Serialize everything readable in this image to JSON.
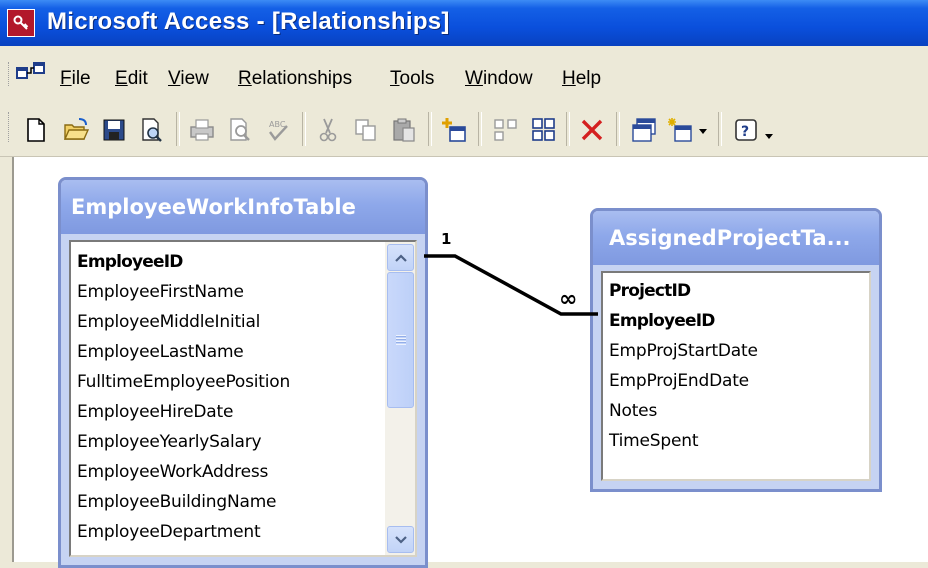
{
  "window": {
    "title": "Microsoft Access - [Relationships]"
  },
  "menu": {
    "items": [
      {
        "label": "File"
      },
      {
        "label": "Edit"
      },
      {
        "label": "View"
      },
      {
        "label": "Relationships"
      },
      {
        "label": "Tools"
      },
      {
        "label": "Window"
      },
      {
        "label": "Help"
      }
    ]
  },
  "toolbar": {
    "buttons": [
      {
        "icon": "new-icon"
      },
      {
        "icon": "open-icon"
      },
      {
        "icon": "save-icon"
      },
      {
        "icon": "file-search-icon"
      },
      {
        "icon": "print-icon"
      },
      {
        "icon": "print-preview-icon"
      },
      {
        "icon": "spelling-icon"
      },
      {
        "icon": "cut-icon"
      },
      {
        "icon": "copy-icon"
      },
      {
        "icon": "paste-icon"
      },
      {
        "icon": "show-table-icon"
      },
      {
        "icon": "show-direct-icon"
      },
      {
        "icon": "show-all-icon"
      },
      {
        "icon": "delete-icon"
      },
      {
        "icon": "database-window-icon"
      },
      {
        "icon": "new-object-icon"
      },
      {
        "icon": "help-icon"
      }
    ]
  },
  "tables": {
    "employee": {
      "name": "EmployeeWorkInfoTable",
      "fields": [
        {
          "name": "EmployeeID",
          "primary_key": true
        },
        {
          "name": "EmployeeFirstName",
          "primary_key": false
        },
        {
          "name": "EmployeeMiddleInitial",
          "primary_key": false
        },
        {
          "name": "EmployeeLastName",
          "primary_key": false
        },
        {
          "name": "FulltimeEmployeePosition",
          "primary_key": false
        },
        {
          "name": "EmployeeHireDate",
          "primary_key": false
        },
        {
          "name": "EmployeeYearlySalary",
          "primary_key": false
        },
        {
          "name": "EmployeeWorkAddress",
          "primary_key": false
        },
        {
          "name": "EmployeeBuildingName",
          "primary_key": false
        },
        {
          "name": "EmployeeDepartment",
          "primary_key": false
        }
      ]
    },
    "assigned": {
      "name": "AssignedProjectTa...",
      "fields": [
        {
          "name": "ProjectID",
          "primary_key": true
        },
        {
          "name": "EmployeeID",
          "primary_key": true
        },
        {
          "name": "EmpProjStartDate",
          "primary_key": false
        },
        {
          "name": "EmpProjEndDate",
          "primary_key": false
        },
        {
          "name": "Notes",
          "primary_key": false
        },
        {
          "name": "TimeSpent",
          "primary_key": false
        }
      ]
    }
  },
  "relationship": {
    "one_side_label": "1",
    "many_side_label": "∞"
  },
  "colors": {
    "titlebar": "#0a4fdc",
    "table_header": "#8ea8ea",
    "chrome": "#ece9d8"
  }
}
